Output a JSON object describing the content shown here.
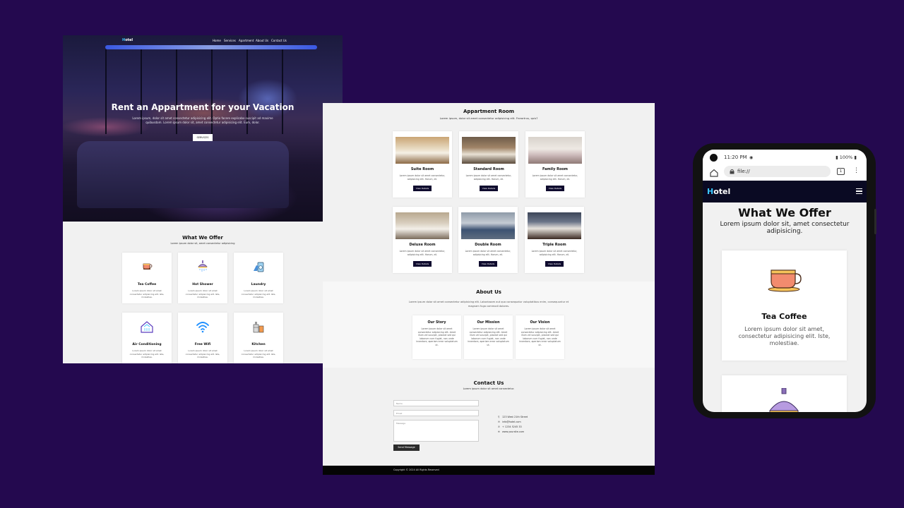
{
  "colors": {
    "page_bg": "#24094f",
    "navy": "#0f0b2e",
    "accent": "#3cc7ff",
    "footer": "#050505"
  },
  "desktop_home": {
    "logo": {
      "first": "H",
      "rest": "otel"
    },
    "nav": [
      "Home",
      "Services",
      "Apartment",
      "About Us",
      "Contact Us"
    ],
    "hero": {
      "title": "Rent an Appartment for your Vacation",
      "subtitle": "Lorem ipsum, dolor sit amet consectetur adipisicing elit. Optio facere explicabo suscipit ad maxime quibusdam. Lorem ipsum dolor sit, amet consectetur adipisicing elit. Eum, dolor.",
      "button": "SERVICES"
    },
    "offer": {
      "title": "What We Offer",
      "subtitle": "Lorem ipsum dolor sit, amet consectetur adipisicing",
      "cards": [
        {
          "icon": "tea-cup-icon",
          "title": "Tea Coffee",
          "desc": "Lorem ipsum dolor sit amet consectetur adipisicing elit. Iste, molestiae."
        },
        {
          "icon": "shower-icon",
          "title": "Hot Shower",
          "desc": "Lorem ipsum dolor sit amet consectetur adipisicing elit. Iste, molestiae."
        },
        {
          "icon": "laundry-icon",
          "title": "Laundry",
          "desc": "Lorem ipsum dolor sit amet consectetur adipisicing elit. Iste, molestiae."
        },
        {
          "icon": "air-conditioning-icon",
          "title": "Air Conditioning",
          "desc": "Lorem ipsum dolor sit amet consectetur adipisicing elit. Iste, molestiae."
        },
        {
          "icon": "wifi-icon",
          "title": "Free Wifi",
          "desc": "Lorem ipsum dolor sit amet consectetur adipisicing elit. Iste, molestiae."
        },
        {
          "icon": "kitchen-icon",
          "title": "Kitchen",
          "desc": "Lorem ipsum dolor sit amet consectetur adipisicing elit. Iste, molestiae."
        }
      ]
    }
  },
  "desktop_rooms": {
    "rooms": {
      "title": "Appartment Room",
      "subtitle": "Lorem ipsum, dolor sit amet consectetur adipisicing elit. Fneartrus, quis?",
      "button": "View Details",
      "cards": [
        {
          "title": "Suite Room",
          "desc": "Lorem ipsum dolor sit amet consectetur, adipisicing elit. Harum, eli."
        },
        {
          "title": "Standard Room",
          "desc": "Lorem ipsum dolor sit amet consectetur, adipisicing elit. Harum, eli."
        },
        {
          "title": "Family Room",
          "desc": "Lorem ipsum dolor sit amet consectetur, adipisicing elit. Harum, eli."
        },
        {
          "title": "Deluxe Room",
          "desc": "Lorem ipsum dolor sit amet consectetur, adipisicing elit. Harum, eli."
        },
        {
          "title": "Double Room",
          "desc": "Lorem ipsum dolor sit amet consectetur, adipisicing elit. Harum, eli."
        },
        {
          "title": "Triple Room",
          "desc": "Lorem ipsum dolor sit amet consectetur, adipisicing elit. Harum, eli."
        }
      ]
    },
    "about": {
      "title": "About Us",
      "subtitle": "Lorem ipsum dolor sit amet consectetur adipisicing elit. Laboriosam aut quo consequatur voluptatibus enim, consequuntur et magnam fuga commodi dolores.",
      "cards": [
        {
          "title": "Our Story",
          "desc": "Lorem ipsum dolor sit amet consectetur adipisicing elit. Amet illum vel suscipit, placeat sed qui laborum cum fugiat, non unde inventore, aperiam error voluptatum ut."
        },
        {
          "title": "Our Mission",
          "desc": "Lorem ipsum dolor sit amet consectetur adipisicing elit. Amet illum vel suscipit, placeat sed qui laborum cum fugiat, non unde inventore, aperiam error voluptatum ut."
        },
        {
          "title": "Our Vision",
          "desc": "Lorem ipsum dolor sit amet consectetur adipisicing elit. Amet illum vel suscipit, placeat sed qui laborum cum fugiat, non unde inventore, aperiam error voluptatum ut."
        }
      ]
    },
    "contact": {
      "title": "Contact Us",
      "subtitle": "Lorem ipsum dolor sit amet consectetur.",
      "name_placeholder": "Name",
      "email_placeholder": "Email",
      "message_placeholder": "Message",
      "send_button": "Send Message",
      "info": [
        {
          "icon": "location-icon",
          "text": "123 West 21th Street"
        },
        {
          "icon": "mail-icon",
          "text": "info@hotel.com"
        },
        {
          "icon": "phone-icon",
          "text": "+ 1234 5245 33"
        },
        {
          "icon": "globe-icon",
          "text": "www.yoursite.com"
        }
      ]
    },
    "footer": "Copyright © 2024 All Rights Reserved"
  },
  "mobile": {
    "status": {
      "time": "11:20 PM",
      "battery": "100%"
    },
    "url": "file://",
    "tab_count": "1",
    "logo": {
      "first": "H",
      "rest": "otel"
    },
    "offer_title": "What We Offer",
    "offer_subtitle": "Lorem ipsum dolor sit, amet consectetur adipisicing.",
    "card_title": "Tea Coffee",
    "card_desc": "Lorem ipsum dolor sit amet, consectetur adipisicing elit. Iste, molestiae."
  }
}
